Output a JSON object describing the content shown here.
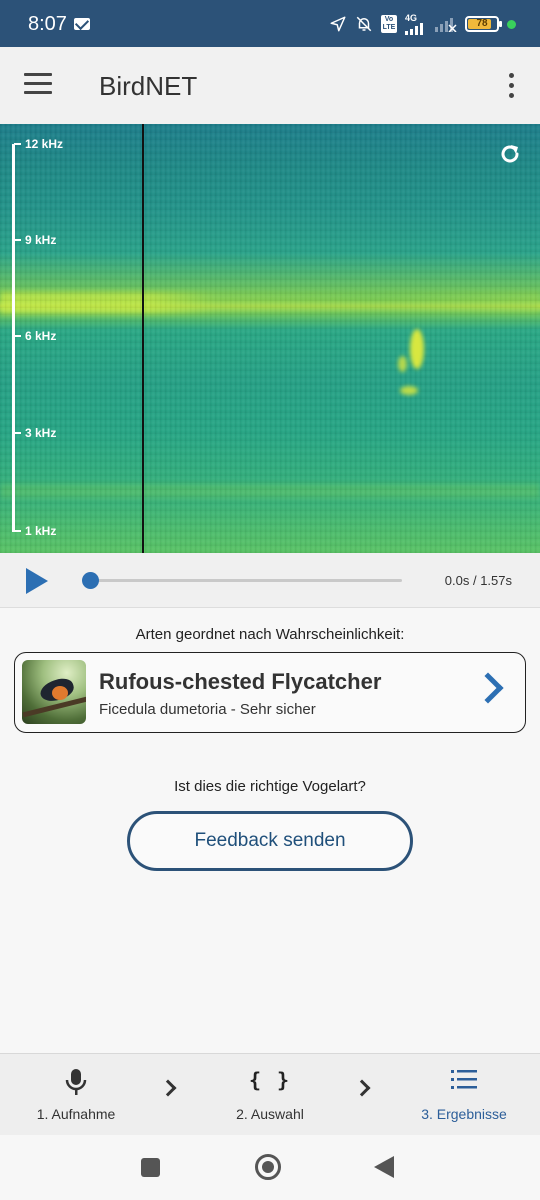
{
  "status_bar": {
    "time": "8:07",
    "network_label": "4G",
    "volte_label": "Vo LTE",
    "battery_level": "78",
    "icons": [
      "mail-icon",
      "location-arrow-icon",
      "bell-off-icon",
      "volte-icon",
      "signal-icon",
      "signal-off-icon",
      "battery-icon",
      "dot-indicator"
    ]
  },
  "appbar": {
    "title": "BirdNET",
    "icons": [
      "menu-icon",
      "more-vert-icon"
    ]
  },
  "spectrogram": {
    "freq_labels": [
      "12 kHz",
      "9 kHz",
      "6 kHz",
      "3 kHz",
      "1 kHz"
    ],
    "icons": [
      "refresh-icon"
    ]
  },
  "player": {
    "time": "0.0s / 1.57s",
    "progress": 0.0,
    "icons": [
      "play-icon"
    ]
  },
  "results": {
    "sort_label": "Arten geordnet nach Wahrscheinlichkeit:",
    "items": [
      {
        "common_name": "Rufous-chested Flycatcher",
        "scientific_line": "Ficedula dumetoria - Sehr sicher"
      }
    ],
    "question": "Ist dies die richtige Vogelart?",
    "feedback_label": "Feedback senden"
  },
  "bottom_nav": {
    "items": [
      {
        "label": "1. Aufnahme",
        "icon": "microphone-icon",
        "active": false
      },
      {
        "label": "2. Auswahl",
        "icon": "braces-icon",
        "active": false
      },
      {
        "label": "3. Ergebnisse",
        "icon": "list-icon",
        "active": true
      }
    ],
    "braces_glyph": "{ }"
  },
  "colors": {
    "status_bar": "#2c5278",
    "accent": "#2c6fb3",
    "active_nav": "#2c5e99",
    "battery": "#f0b93b",
    "indicator_dot": "#39d05c"
  }
}
